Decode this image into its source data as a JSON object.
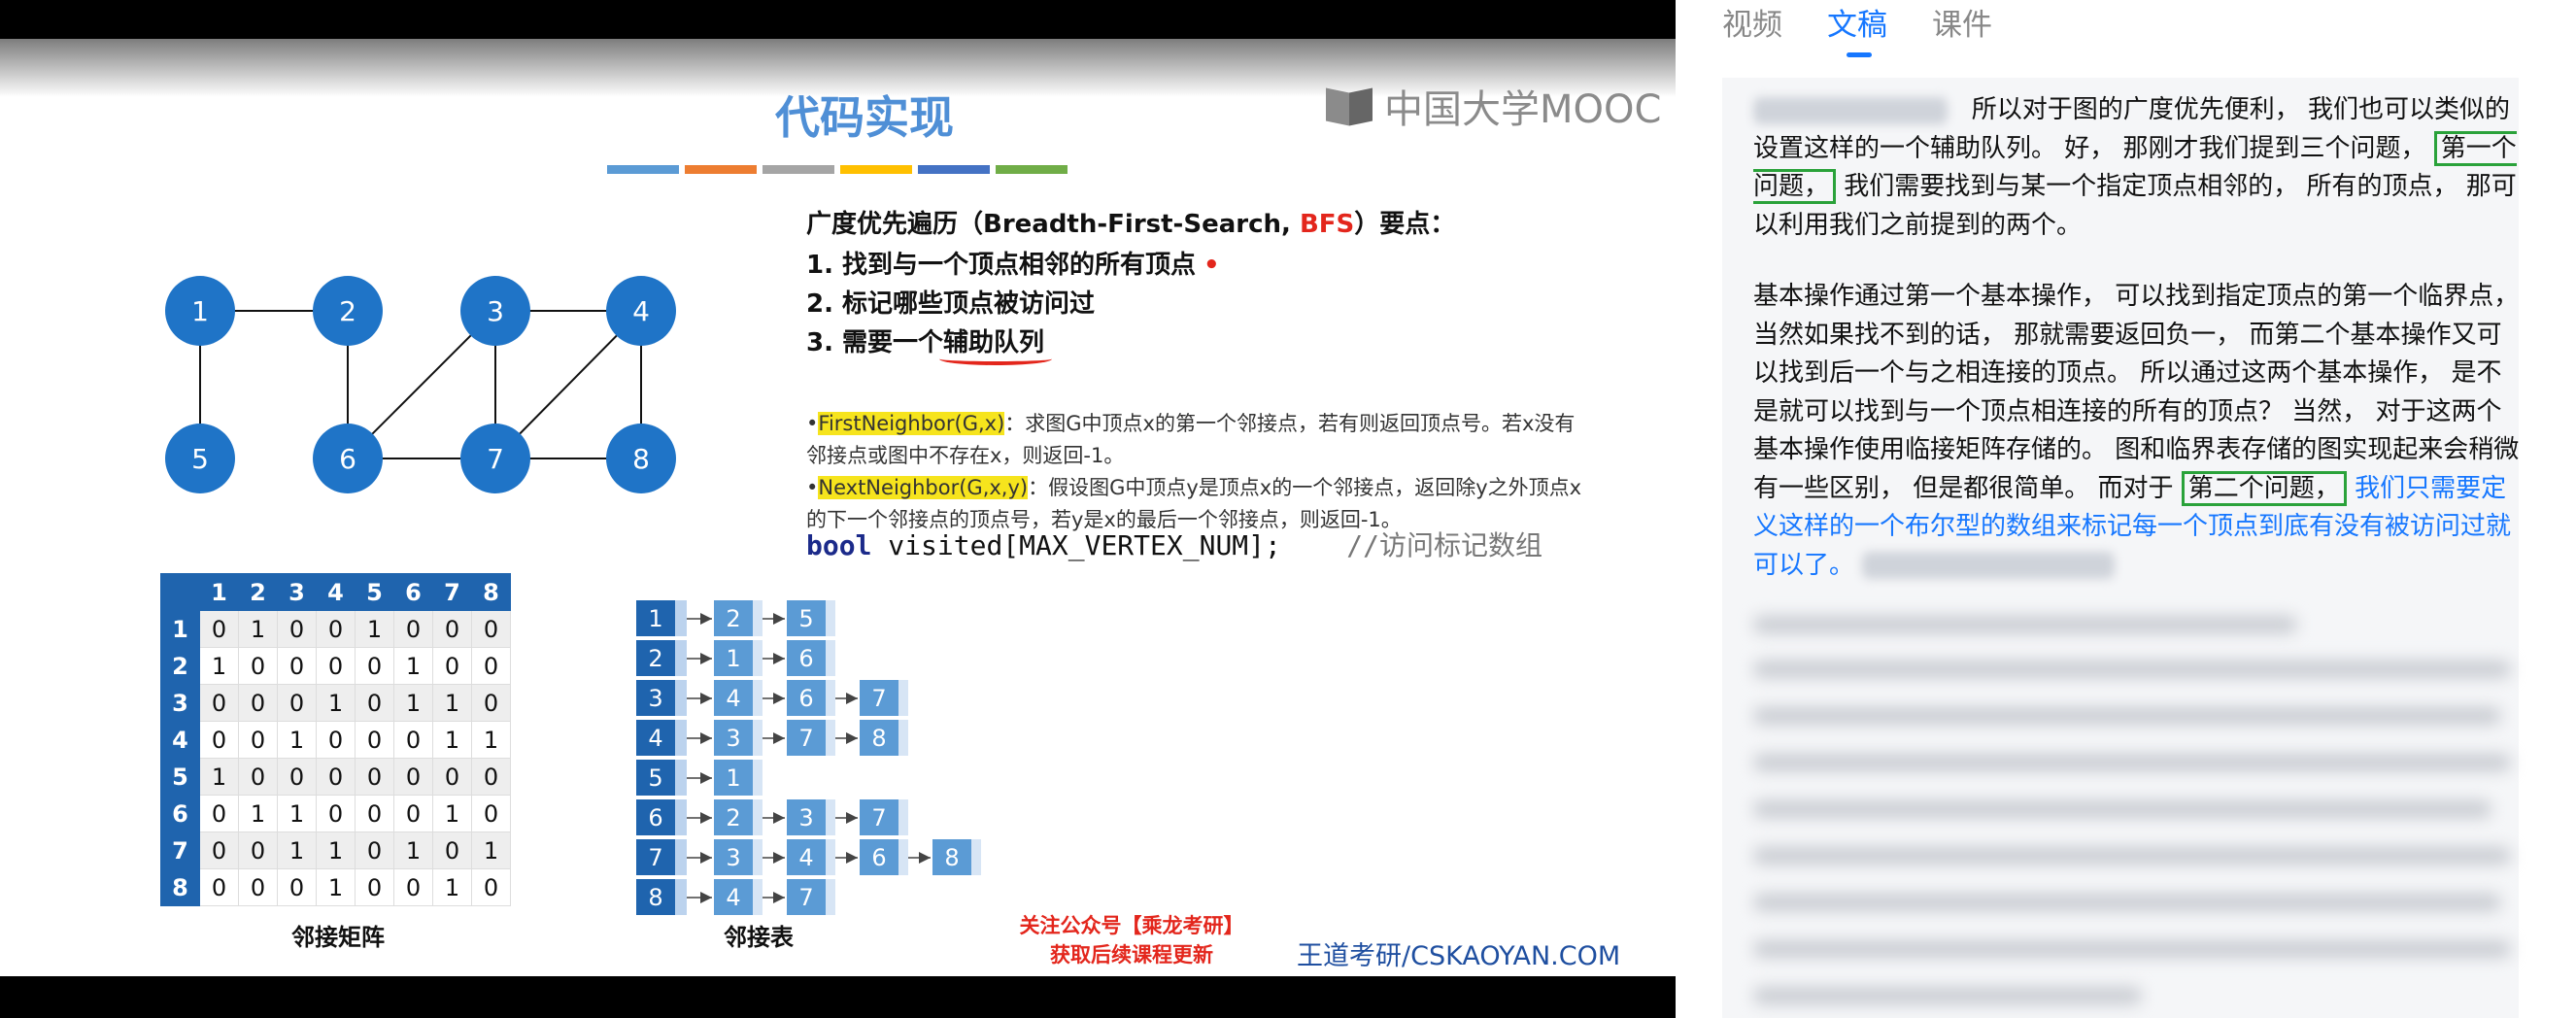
{
  "slide": {
    "title": "代码实现",
    "logo_text": "中国大学MOOC",
    "bar_colors": [
      "#5b9bd5",
      "#ed7d31",
      "#a5a5a5",
      "#ffc000",
      "#4472c4",
      "#70ad47"
    ],
    "bfs_heading_pre": "广度优先遍历（Breadth-First-Search, ",
    "bfs_heading_red": "BFS",
    "bfs_heading_post": "）要点：",
    "point1": "1.  找到与一个顶点相邻的所有顶点",
    "point2": "2.  标记哪些顶点被访问过",
    "point3_pre": "3.  需要一个",
    "point3_ul": "辅助队列",
    "fn1_name": "FirstNeighbor(G,x)",
    "fn1_desc": "：求图G中顶点x的第一个邻接点，若有则返回顶点号。若x没有邻接点或图中不存在x，则返回-1。",
    "fn2_name": "NextNeighbor(G,x,y)",
    "fn2_desc": "：假设图G中顶点y是顶点x的一个邻接点，返回除y之外顶点x的下一个邻接点的顶点号，若y是x的最后一个邻接点，则返回-1。",
    "code_kw": "bool",
    "code_body": " visited[MAX_VERTEX_NUM];",
    "code_comment": "    //访问标记数组",
    "matrix_caption": "邻接矩阵",
    "list_caption": "邻接表",
    "follow_line1": "关注公众号【乘龙考研】",
    "follow_line2": "获取后续课程更新",
    "site": "王道考研/CSKAOYAN.COM",
    "graph_vertices": [
      "1",
      "2",
      "3",
      "4",
      "5",
      "6",
      "7",
      "8"
    ],
    "graph_edges": [
      [
        1,
        2
      ],
      [
        1,
        5
      ],
      [
        2,
        6
      ],
      [
        3,
        4
      ],
      [
        3,
        6
      ],
      [
        3,
        7
      ],
      [
        4,
        7
      ],
      [
        4,
        8
      ],
      [
        6,
        7
      ],
      [
        7,
        8
      ]
    ],
    "matrix_headers": [
      "1",
      "2",
      "3",
      "4",
      "5",
      "6",
      "7",
      "8"
    ],
    "matrix": [
      [
        "0",
        "1",
        "0",
        "0",
        "1",
        "0",
        "0",
        "0"
      ],
      [
        "1",
        "0",
        "0",
        "0",
        "0",
        "1",
        "0",
        "0"
      ],
      [
        "0",
        "0",
        "0",
        "1",
        "0",
        "1",
        "1",
        "0"
      ],
      [
        "0",
        "0",
        "1",
        "0",
        "0",
        "0",
        "1",
        "1"
      ],
      [
        "1",
        "0",
        "0",
        "0",
        "0",
        "0",
        "0",
        "0"
      ],
      [
        "0",
        "1",
        "1",
        "0",
        "0",
        "0",
        "1",
        "0"
      ],
      [
        "0",
        "0",
        "1",
        "1",
        "0",
        "1",
        "0",
        "1"
      ],
      [
        "0",
        "0",
        "0",
        "1",
        "0",
        "0",
        "1",
        "0"
      ]
    ],
    "adj_list": [
      [
        "2",
        "5"
      ],
      [
        "1",
        "6"
      ],
      [
        "4",
        "6",
        "7"
      ],
      [
        "3",
        "7",
        "8"
      ],
      [
        "1"
      ],
      [
        "2",
        "3",
        "7"
      ],
      [
        "3",
        "4",
        "6",
        "8"
      ],
      [
        "4",
        "7"
      ]
    ],
    "colors": {
      "node": "#1f74c7",
      "cell": "#5b9bd5",
      "header": "#1f64ae",
      "accent_red": "#e3261c"
    }
  },
  "panel": {
    "tabs": [
      {
        "label": "视频"
      },
      {
        "label": "文稿"
      },
      {
        "label": "课件"
      }
    ],
    "active_tab": "文稿",
    "para1_a": "所以对于图的广度优先便利， 我们也可以类似的设置这样的一个辅助队列。 好， 那刚才我们提到三个问题，",
    "para1_box": "第一个问题，",
    "para1_b": "我们需要找到与某一个指定顶点相邻的， 所有的顶点， 那可以利用我们之前提到的两个。",
    "para2_a": "基本操作通过第一个基本操作， 可以找到指定顶点的第一个临界点， 当然如果找不到的话， 那就需要返回负一， 而第二个基本操作又可以找到后一个与之相连接的顶点。 所以通过这两个基本操作， 是不是就可以找到与一个顶点相连接的所有的顶点？ 当然， 对于这两个基本操作使用临接矩阵存储的。 图和临界表存储的图实现起来会稍微有一些区别， 但是都很简单。 而对于",
    "para2_box": "第二个问题，",
    "para2_blue": "我们只需要定义这样的一个布尔型的数组来标记每一个顶点到底有没有被访问过就可以了。"
  }
}
